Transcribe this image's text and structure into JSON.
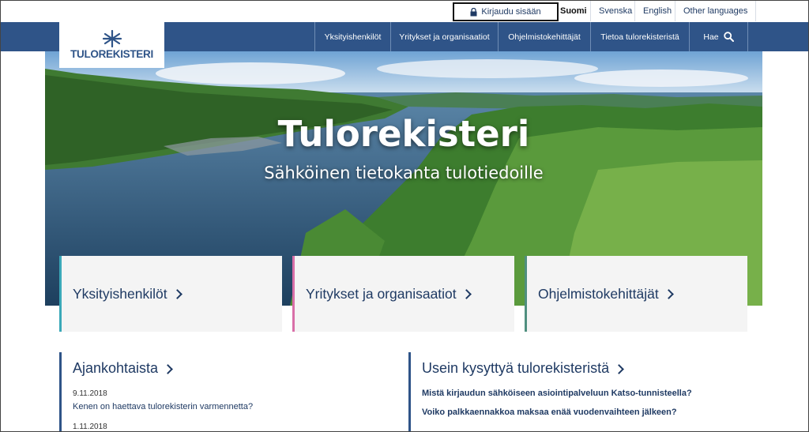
{
  "utility": {
    "login_label": "Kirjaudu sisään",
    "languages": [
      "Suomi",
      "Svenska",
      "English",
      "Other languages"
    ]
  },
  "brand": {
    "logo_text": "TULOREKISTERI"
  },
  "nav": {
    "items": [
      "Yksityishenkilöt",
      "Yritykset ja organisaatiot",
      "Ohjelmistokehittäjät",
      "Tietoa tulorekisteristä"
    ],
    "search_label": "Hae"
  },
  "hero": {
    "title": "Tulorekisteri",
    "subtitle": "Sähköinen tietokanta tulotiedoille"
  },
  "cards": [
    {
      "label": "Yksityishenkilöt",
      "accent": "#3aa8b8"
    },
    {
      "label": "Yritykset ja organisaatiot",
      "accent": "#d96fa8"
    },
    {
      "label": "Ohjelmistokehittäjät",
      "accent": "#4f8f7f"
    }
  ],
  "news": {
    "heading": "Ajankohtaista",
    "items": [
      {
        "date": "9.11.2018",
        "title": "Kenen on haettava tulorekisterin varmennetta?"
      },
      {
        "date": "1.11.2018",
        "title": ""
      }
    ]
  },
  "faq": {
    "heading": "Usein kysyttyä tulorekisteristä",
    "items": [
      "Mistä kirjaudun sähköiseen asiointipalveluun Katso-tunnisteella?",
      "Voiko palkkaennakkoa maksaa enää vuodenvaihteen jälkeen?"
    ]
  },
  "colors": {
    "nav_bg": "#2f5488",
    "text": "#1f3a63",
    "card_bg": "#f4f4f4"
  }
}
